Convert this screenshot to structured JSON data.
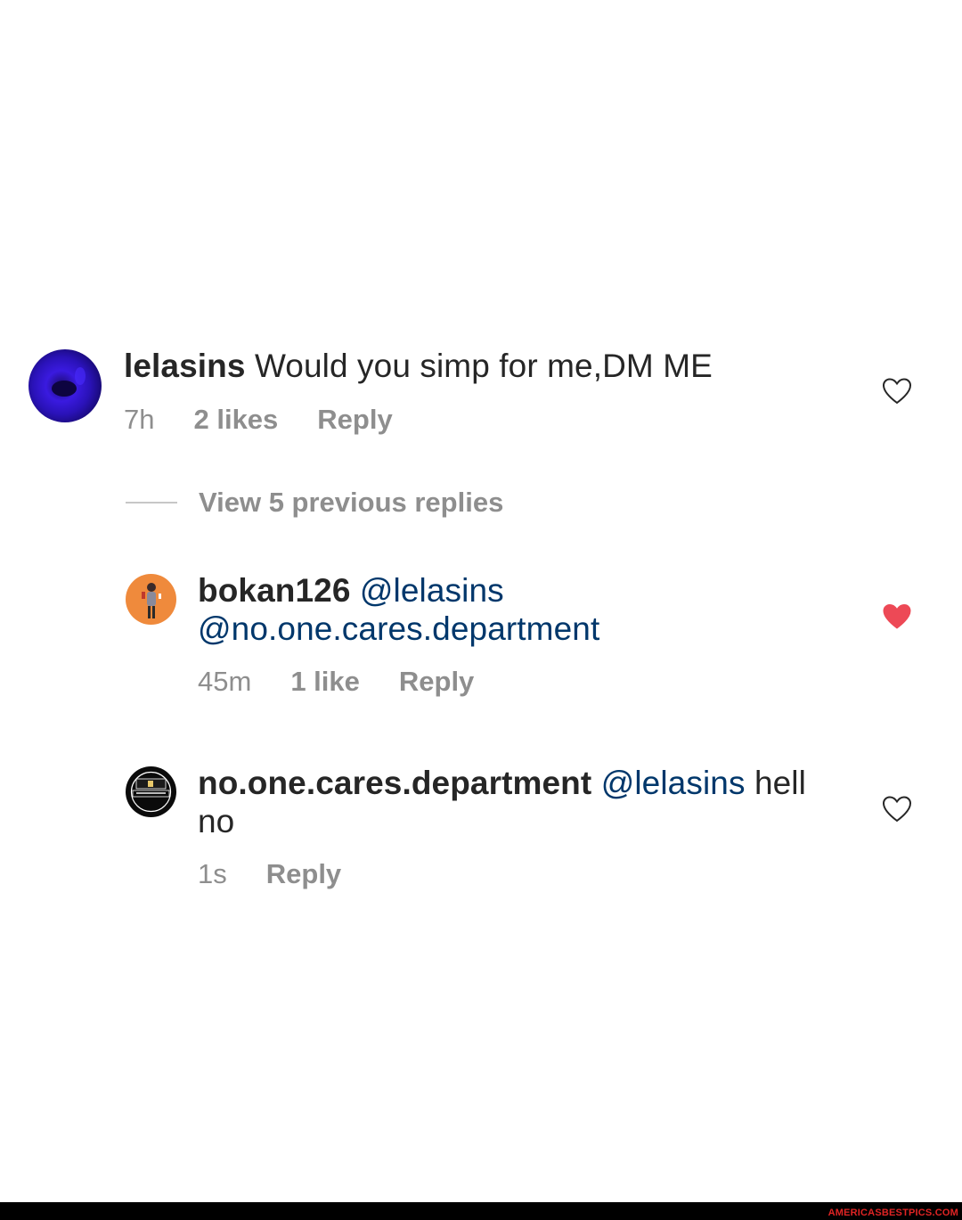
{
  "comments": [
    {
      "username": "lelasins",
      "text": "Would you simp for me,DM ME",
      "time": "7h",
      "likes": "2 likes",
      "reply": "Reply",
      "liked": false
    },
    {
      "username": "bokan126",
      "mention1": "@lelasins",
      "mention2": "@no.one.cares.department",
      "time": "45m",
      "likes": "1 like",
      "reply": "Reply",
      "liked": true
    },
    {
      "username": "no.one.cares.department",
      "mention1": "@lelasins",
      "text": "hell",
      "text2": "no",
      "time": "1s",
      "reply": "Reply",
      "liked": false
    }
  ],
  "view_replies": "View 5 previous replies",
  "footer": {
    "watermark": "AMERICASBESTPICS.COM"
  },
  "colors": {
    "mention": "#00376b",
    "meta": "#8e8e8e",
    "liked_heart": "#ed4956"
  },
  "icons": {
    "like": "heart-outline-icon",
    "liked": "heart-filled-icon"
  }
}
